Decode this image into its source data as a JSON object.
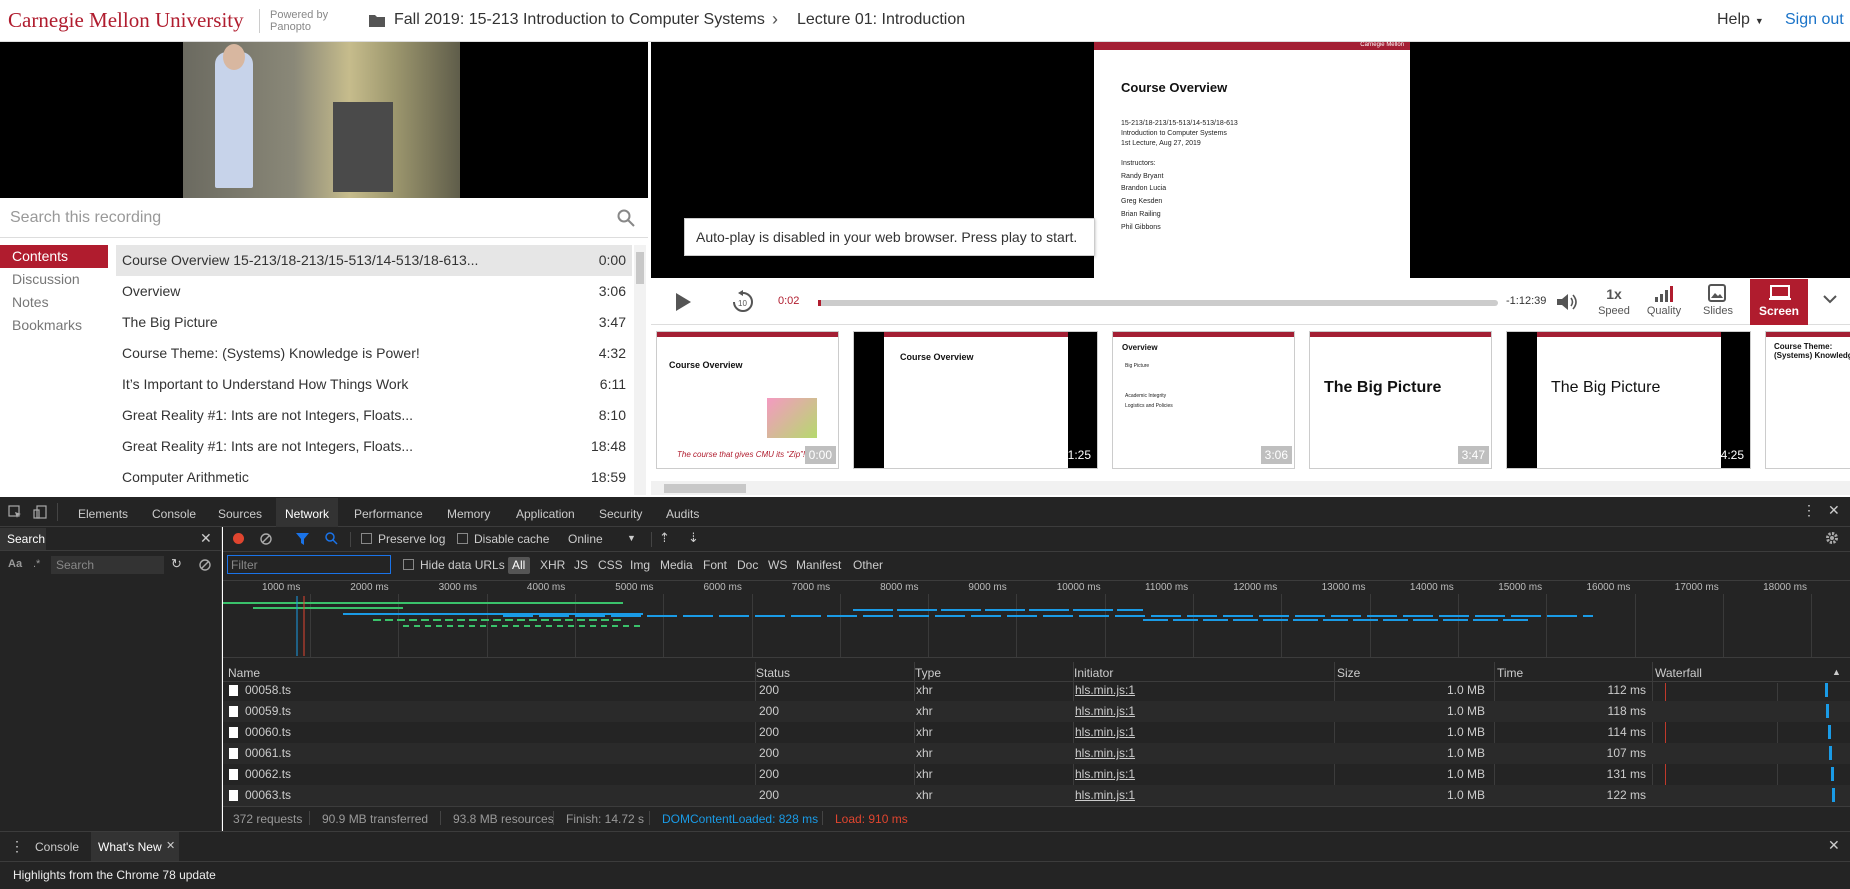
{
  "header": {
    "logo": "Carnegie Mellon University",
    "powered_by_line1": "Powered by",
    "powered_by_line2": "Panopto",
    "breadcrumb_folder": "Fall 2019: 15-213 Introduction to Computer Systems",
    "breadcrumb_session": "Lecture 01: Introduction",
    "help": "Help",
    "sign_out": "Sign out"
  },
  "search": {
    "placeholder": "Search this recording"
  },
  "left_nav": [
    "Contents",
    "Discussion",
    "Notes",
    "Bookmarks"
  ],
  "contents": [
    {
      "title": "Course Overview 15-213/18-213/15-513/14-513/18-613...",
      "time": "0:00"
    },
    {
      "title": "Overview",
      "time": "3:06"
    },
    {
      "title": "The Big Picture",
      "time": "3:47"
    },
    {
      "title": "Course Theme: (Systems) Knowledge is Power!",
      "time": "4:32"
    },
    {
      "title": "It’s Important to Understand How Things Work",
      "time": "6:11"
    },
    {
      "title": "Great Reality #1: Ints are not Integers, Floats...",
      "time": "8:10"
    },
    {
      "title": "Great Reality #1: Ints are not Integers, Floats...",
      "time": "18:48"
    },
    {
      "title": "Computer Arithmetic",
      "time": "18:59"
    }
  ],
  "slide": {
    "brand": "Carnegie Mellon",
    "title": "Course Overview",
    "lines": [
      "15-213/18-213/15-513/14-513/18-613",
      "Introduction to Computer Systems",
      "1st Lecture, Aug 27, 2019"
    ],
    "instructors_label": "Instructors:",
    "instructors": [
      "Randy Bryant",
      "Brandon Lucia",
      "Greg Kesden",
      "Brian Railing",
      "Phil Gibbons"
    ]
  },
  "autoplay_msg": "Auto-play is disabled in your web browser. Press play to start.",
  "player": {
    "current_time": "0:02",
    "remaining_time": "-1:12:39",
    "progress": 0.0005,
    "speed_value": "1x",
    "speed_label": "Speed",
    "quality_label": "Quality",
    "slides_label": "Slides",
    "screen_label": "Screen"
  },
  "thumbnails": [
    {
      "heading": "Course Overview",
      "time": "0:00",
      "caption": "The course that gives CMU its “Zip”!"
    },
    {
      "heading": "Course Overview",
      "time": "1:25"
    },
    {
      "heading": "Overview",
      "time": "3:06",
      "bullets": [
        "Big Picture",
        "Academic Integrity",
        "Logistics and Policies"
      ]
    },
    {
      "heading": "The Big Picture",
      "time": "3:47"
    },
    {
      "heading": "The Big Picture",
      "time": "4:25"
    },
    {
      "heading": "Course Theme: (Systems) Knowledge"
    }
  ],
  "devtools": {
    "tabs": [
      "Elements",
      "Console",
      "Sources",
      "Network",
      "Performance",
      "Memory",
      "Application",
      "Security",
      "Audits"
    ],
    "active_tab": "Network",
    "search_title": "Search",
    "search_aa": "Aa",
    "search_regex": ".*",
    "search_placeholder": "Search",
    "preserve_log": "Preserve log",
    "disable_cache": "Disable cache",
    "throttle": "Online",
    "filter_placeholder": "Filter",
    "hide_data_urls": "Hide data URLs",
    "type_filters": [
      "All",
      "XHR",
      "JS",
      "CSS",
      "Img",
      "Media",
      "Font",
      "Doc",
      "WS",
      "Manifest",
      "Other"
    ],
    "timeline_ticks": [
      "1000 ms",
      "2000 ms",
      "3000 ms",
      "4000 ms",
      "5000 ms",
      "6000 ms",
      "7000 ms",
      "8000 ms",
      "9000 ms",
      "10000 ms",
      "11000 ms",
      "12000 ms",
      "13000 ms",
      "14000 ms",
      "15000 ms",
      "16000 ms",
      "17000 ms",
      "18000 ms"
    ],
    "columns": [
      "Name",
      "Status",
      "Type",
      "Initiator",
      "Size",
      "Time",
      "Waterfall"
    ],
    "rows": [
      {
        "name": "00058.ts",
        "status": "200",
        "type": "xhr",
        "initiator": "hls.min.js:1",
        "size": "1.0 MB",
        "time": "112 ms"
      },
      {
        "name": "00059.ts",
        "status": "200",
        "type": "xhr",
        "initiator": "hls.min.js:1",
        "size": "1.0 MB",
        "time": "118 ms"
      },
      {
        "name": "00060.ts",
        "status": "200",
        "type": "xhr",
        "initiator": "hls.min.js:1",
        "size": "1.0 MB",
        "time": "114 ms"
      },
      {
        "name": "00061.ts",
        "status": "200",
        "type": "xhr",
        "initiator": "hls.min.js:1",
        "size": "1.0 MB",
        "time": "107 ms"
      },
      {
        "name": "00062.ts",
        "status": "200",
        "type": "xhr",
        "initiator": "hls.min.js:1",
        "size": "1.0 MB",
        "time": "131 ms"
      },
      {
        "name": "00063.ts",
        "status": "200",
        "type": "xhr",
        "initiator": "hls.min.js:1",
        "size": "1.0 MB",
        "time": "122 ms"
      }
    ],
    "summary": {
      "requests": "372 requests",
      "transferred": "90.9 MB transferred",
      "resources": "93.8 MB resources",
      "finish": "Finish: 14.72 s",
      "dcl": "DOMContentLoaded: 828 ms",
      "load": "Load: 910 ms"
    },
    "drawer_tabs": [
      "Console",
      "What's New"
    ],
    "drawer_message": "Highlights from the Chrome 78 update"
  },
  "colors": {
    "brand_red": "#b01c2e",
    "link_blue": "#1a73c8",
    "devtools_bg": "#242424",
    "dcl_blue": "#1a9be6",
    "load_red": "#e0452f"
  }
}
